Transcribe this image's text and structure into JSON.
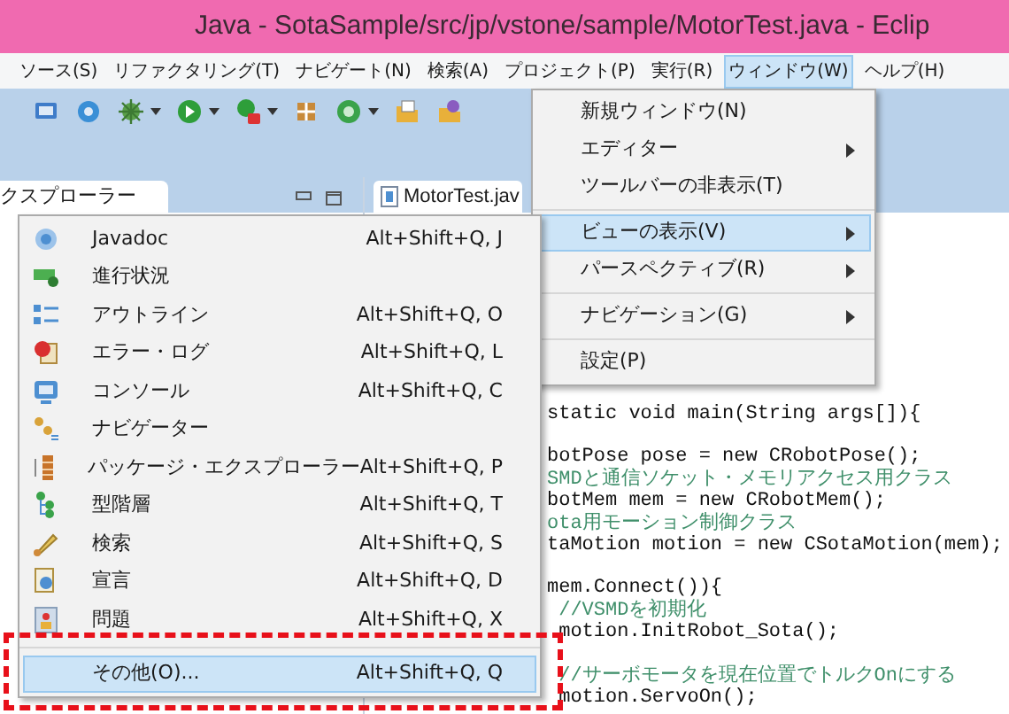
{
  "window": {
    "title": "Java - SotaSample/src/jp/vstone/sample/MotorTest.java - Eclip"
  },
  "menu_bar": [
    {
      "label": "ソース(S)",
      "selected": false
    },
    {
      "label": "リファクタリング(T)",
      "selected": false
    },
    {
      "label": "ナビゲート(N)",
      "selected": false
    },
    {
      "label": "検索(A)",
      "selected": false
    },
    {
      "label": "プロジェクト(P)",
      "selected": false
    },
    {
      "label": "実行(R)",
      "selected": false
    },
    {
      "label": "ウィンドウ(W)",
      "selected": true
    },
    {
      "label": "ヘルプ(H)",
      "selected": false
    }
  ],
  "explorer_panel": {
    "tab_label": "クスプローラー"
  },
  "editor": {
    "tab_label": "MotorTest.jav",
    "code_blocks": [
      [
        {
          "kind": "code",
          "text": "static void main(String args[]){"
        }
      ],
      [
        {
          "kind": "code",
          "text": "botPose pose = new CRobotPose();"
        },
        {
          "kind": "comment",
          "text": "SMDと通信ソケット・メモリアクセス用クラス"
        },
        {
          "kind": "code",
          "text": "botMem mem = new CRobotMem();"
        },
        {
          "kind": "comment",
          "text": "ota用モーション制御クラス"
        },
        {
          "kind": "code",
          "text": "taMotion motion = new CSotaMotion(mem);"
        }
      ],
      [
        {
          "kind": "code",
          "text": "mem.Connect()){"
        },
        {
          "kind": "comment",
          "text": " //VSMDを初期化"
        },
        {
          "kind": "code",
          "text": " motion.InitRobot_Sota();"
        }
      ],
      [
        {
          "kind": "comment",
          "text": " //サーボモータを現在位置でトルクOnにする"
        },
        {
          "kind": "code",
          "text": " motion.ServoOn();"
        }
      ]
    ]
  },
  "window_menu": [
    [
      {
        "label": "新規ウィンドウ(N)",
        "submenu": false,
        "selected": false
      },
      {
        "label": "エディター",
        "submenu": true,
        "selected": false
      },
      {
        "label": "ツールバーの非表示(T)",
        "submenu": false,
        "selected": false
      }
    ],
    [
      {
        "label": "ビューの表示(V)",
        "submenu": true,
        "selected": true
      },
      {
        "label": "パースペクティブ(R)",
        "submenu": true,
        "selected": false
      }
    ],
    [
      {
        "label": "ナビゲーション(G)",
        "submenu": true,
        "selected": false
      }
    ],
    [
      {
        "label": "設定(P)",
        "submenu": false,
        "selected": false
      }
    ]
  ],
  "show_view_menu": [
    [
      {
        "label": "Javadoc",
        "shortcut": "Alt+Shift+Q, J",
        "selected": false
      },
      {
        "label": "進行状況",
        "selected": false
      },
      {
        "label": "アウトライン",
        "shortcut": "Alt+Shift+Q, O",
        "selected": false
      },
      {
        "label": "エラー・ログ",
        "shortcut": "Alt+Shift+Q, L",
        "selected": false
      },
      {
        "label": "コンソール",
        "shortcut": "Alt+Shift+Q, C",
        "selected": false
      },
      {
        "label": "ナビゲーター",
        "selected": false
      },
      {
        "label": "パッケージ・エクスプローラー",
        "shortcut": "Alt+Shift+Q, P",
        "selected": false
      },
      {
        "label": "型階層",
        "shortcut": "Alt+Shift+Q, T",
        "selected": false
      },
      {
        "label": "検索",
        "shortcut": "Alt+Shift+Q, S",
        "selected": false
      },
      {
        "label": "宣言",
        "shortcut": "Alt+Shift+Q, D",
        "selected": false
      },
      {
        "label": "問題",
        "shortcut": "Alt+Shift+Q, X",
        "selected": false
      }
    ],
    [
      {
        "label": "その他(O)...",
        "shortcut": "Alt+Shift+Q, Q",
        "selected": true
      }
    ]
  ]
}
